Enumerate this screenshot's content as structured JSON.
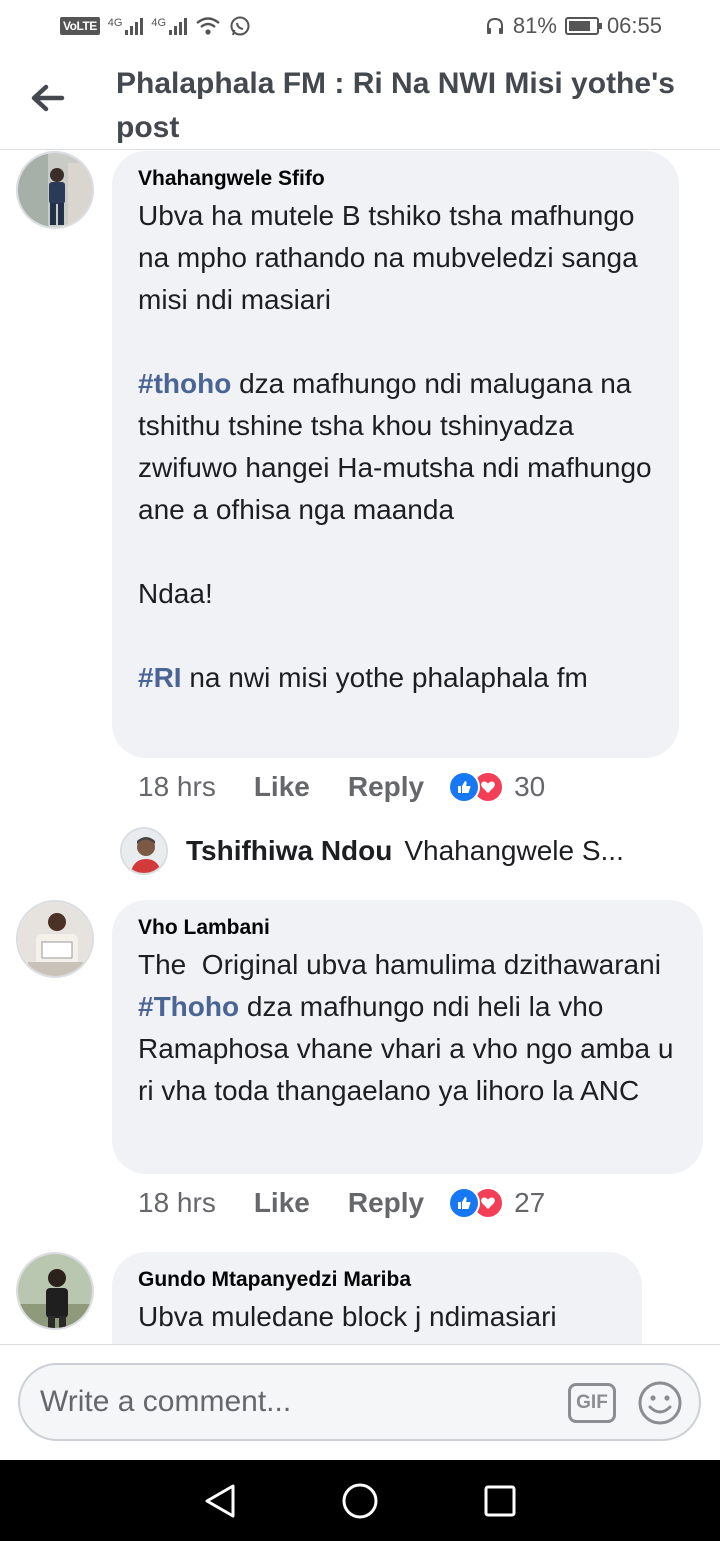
{
  "status_bar": {
    "volte": "VoLTE",
    "net1": "4G",
    "net2": "4G",
    "battery": "81%",
    "battery_level": 0.81,
    "time": "06:55"
  },
  "header": {
    "title": "Phalaphala FM : Ri Na NWI Misi yothe's post"
  },
  "comments": [
    {
      "author": "Vhahangwele Sfifo",
      "paragraphs": [
        [
          {
            "t": "Ubva ha mutele B tshiko tsha mafhungo na mpho rathando na mubveledzi sanga misi ndi masiari"
          }
        ],
        [
          {
            "t": "#thoho",
            "tag": true
          },
          {
            "t": " dza mafhungo ndi malugana na tshithu tshine tsha khou tshinyadza zwifuwo hangei Ha-mutsha ndi mafhungo ane a ofhisa nga maanda"
          }
        ],
        [
          {
            "t": "Ndaa!"
          }
        ],
        [
          {
            "t": "#RI",
            "tag": true
          },
          {
            "t": " na nwi misi yothe phalaphala fm"
          }
        ]
      ],
      "time": "18 hrs",
      "like": "Like",
      "reply": "Reply",
      "reaction_count": "30",
      "reply_preview": {
        "author": "Tshifhiwa Ndou",
        "snippet": "Vhahangwele S..."
      }
    },
    {
      "author": "Vho Lambani",
      "paragraphs": [
        [
          {
            "t": "The  Original ubva hamulima dzithawarani "
          },
          {
            "t": "#Thoho",
            "tag": true
          },
          {
            "t": " dza mafhungo ndi heli la vho Ramaphosa vhane vhari a vho ngo amba u ri vha toda thangaelano ya lihoro la ANC"
          }
        ]
      ],
      "time": "18 hrs",
      "like": "Like",
      "reply": "Reply",
      "reaction_count": "27"
    },
    {
      "author": "Gundo Mtapanyedzi Mariba",
      "paragraphs": [
        [
          {
            "t": "Ubva muledane block j ndimasiari"
          }
        ]
      ]
    }
  ],
  "composer": {
    "placeholder": "Write a comment...",
    "gif_label": "GIF"
  },
  "colors": {
    "bubble": "#f0f2f5",
    "hashtag": "#4a6494",
    "like_blue": "#1877f2",
    "love_red": "#f33e58"
  }
}
